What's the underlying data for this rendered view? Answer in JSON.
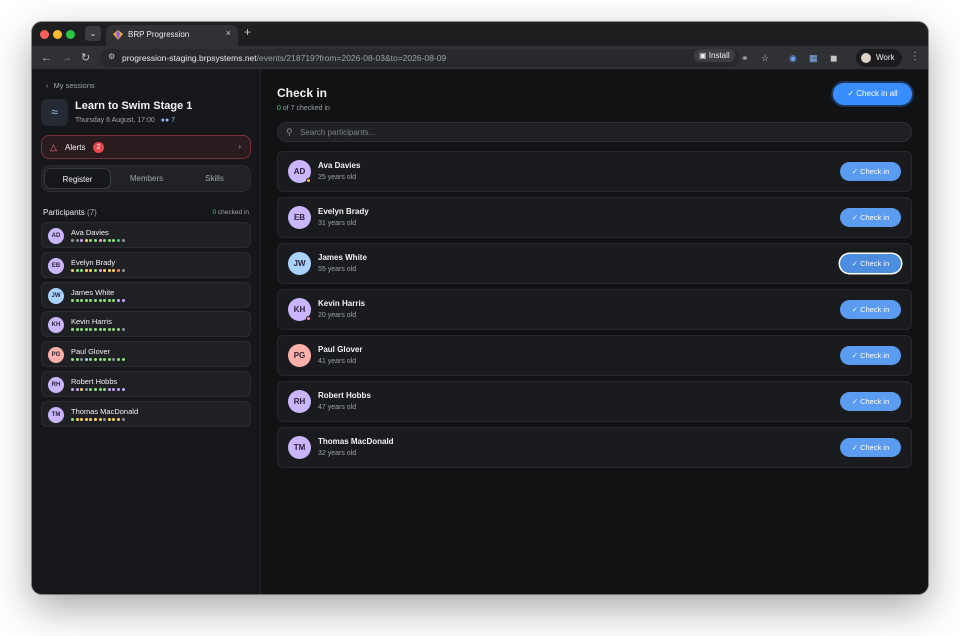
{
  "browser": {
    "tab_title": "BRP Progression",
    "url_host": "progression-staging.brpsystems.net",
    "url_path": "/events/218719?from=2026-08-03&to=2026-08-09",
    "install_label": "Install",
    "profile_label": "Work"
  },
  "sidebar": {
    "back_label": "My sessions",
    "session_title": "Learn to Swim Stage 1",
    "session_datetime": "Thursday 6 August, 17:00",
    "session_count": "7",
    "alerts_label": "Alerts",
    "alerts_count": "2",
    "tabs": [
      "Register",
      "Members",
      "Skills"
    ],
    "participants_label": "Participants",
    "participants_count": "(7)",
    "checked_count": "0",
    "checked_label": "checked in",
    "participants": [
      {
        "initials": "AD",
        "name": "Ava Davies",
        "color": "#c9b6ff",
        "dots": [
          "#8e93a0",
          "#8e93a0",
          "#c9a7ff",
          "#ffd25a",
          "#8ee07a",
          "#8ee07a",
          "#ff9bd2",
          "#8ee07a",
          "#8ee07a",
          "#8ee07a",
          "#3fcf6e",
          "#8e93a0"
        ]
      },
      {
        "initials": "EB",
        "name": "Evelyn Brady",
        "color": "#c9b6ff",
        "dots": [
          "#ffd25a",
          "#8ee07a",
          "#8ee07a",
          "#ffd25a",
          "#ffd25a",
          "#8ee07a",
          "#ff9bd2",
          "#ffd25a",
          "#ffd25a",
          "#ffd25a",
          "#ff8c5a",
          "#8e93a0"
        ]
      },
      {
        "initials": "JW",
        "name": "James White",
        "color": "#a8d2ff",
        "dots": [
          "#8ee07a",
          "#8ee07a",
          "#8ee07a",
          "#8ee07a",
          "#8ee07a",
          "#8ee07a",
          "#8ee07a",
          "#8ee07a",
          "#8ee07a",
          "#8ee07a",
          "#c9a7ff",
          "#c9a7ff"
        ]
      },
      {
        "initials": "KH",
        "name": "Kevin Harris",
        "color": "#c9b6ff",
        "dots": [
          "#8ee07a",
          "#8ee07a",
          "#8ee07a",
          "#8ee07a",
          "#8ee07a",
          "#8ee07a",
          "#8ee07a",
          "#8ee07a",
          "#8ee07a",
          "#8ee07a",
          "#8ee07a",
          "#8e93a0"
        ]
      },
      {
        "initials": "PG",
        "name": "Paul Glover",
        "color": "#ffb0a8",
        "dots": [
          "#8ee07a",
          "#8ee07a",
          "#8e93a0",
          "#a8d2ff",
          "#8ee07a",
          "#8ee07a",
          "#8ee07a",
          "#8ee07a",
          "#8ee07a",
          "#8e93a0",
          "#8ee07a",
          "#8ee07a"
        ]
      },
      {
        "initials": "RH",
        "name": "Robert Hobbs",
        "color": "#c9b6ff",
        "dots": [
          "#c9a7ff",
          "#c9a7ff",
          "#ffd25a",
          "#8e93a0",
          "#8ee07a",
          "#8ee07a",
          "#8ee07a",
          "#8ee07a",
          "#c9a7ff",
          "#c9a7ff",
          "#c9a7ff",
          "#c9a7ff"
        ]
      },
      {
        "initials": "TM",
        "name": "Thomas MacDonald",
        "color": "#c9b6ff",
        "dots": [
          "#8ee07a",
          "#ffd25a",
          "#ffd25a",
          "#ffd25a",
          "#ffd25a",
          "#ffd25a",
          "#ffd25a",
          "#8e93a0",
          "#ffd25a",
          "#ffd25a",
          "#ffd25a",
          "#8e93a0"
        ]
      }
    ]
  },
  "main": {
    "title": "Check in",
    "checked_count": "0",
    "checked_suffix": "of 7 checked in",
    "check_all_label": "Check in all",
    "search_placeholder": "Search participants...",
    "button_label": "Check in",
    "rows": [
      {
        "initials": "AD",
        "name": "Ava Davies",
        "age": "25 years old",
        "color": "#c9b6ff",
        "status_color": "#ffb020"
      },
      {
        "initials": "EB",
        "name": "Evelyn Brady",
        "age": "31 years old",
        "color": "#c9b6ff",
        "status_color": ""
      },
      {
        "initials": "JW",
        "name": "James White",
        "age": "55 years old",
        "color": "#a8d2ff",
        "status_color": ""
      },
      {
        "initials": "KH",
        "name": "Kevin Harris",
        "age": "20 years old",
        "color": "#c9b6ff",
        "status_color": "#ff8fc8"
      },
      {
        "initials": "PG",
        "name": "Paul Glover",
        "age": "41 years old",
        "color": "#ffb0a8",
        "status_color": ""
      },
      {
        "initials": "RH",
        "name": "Robert Hobbs",
        "age": "47 years old",
        "color": "#c9b6ff",
        "status_color": ""
      },
      {
        "initials": "TM",
        "name": "Thomas MacDonald",
        "age": "32 years old",
        "color": "#c9b6ff",
        "status_color": ""
      }
    ]
  }
}
